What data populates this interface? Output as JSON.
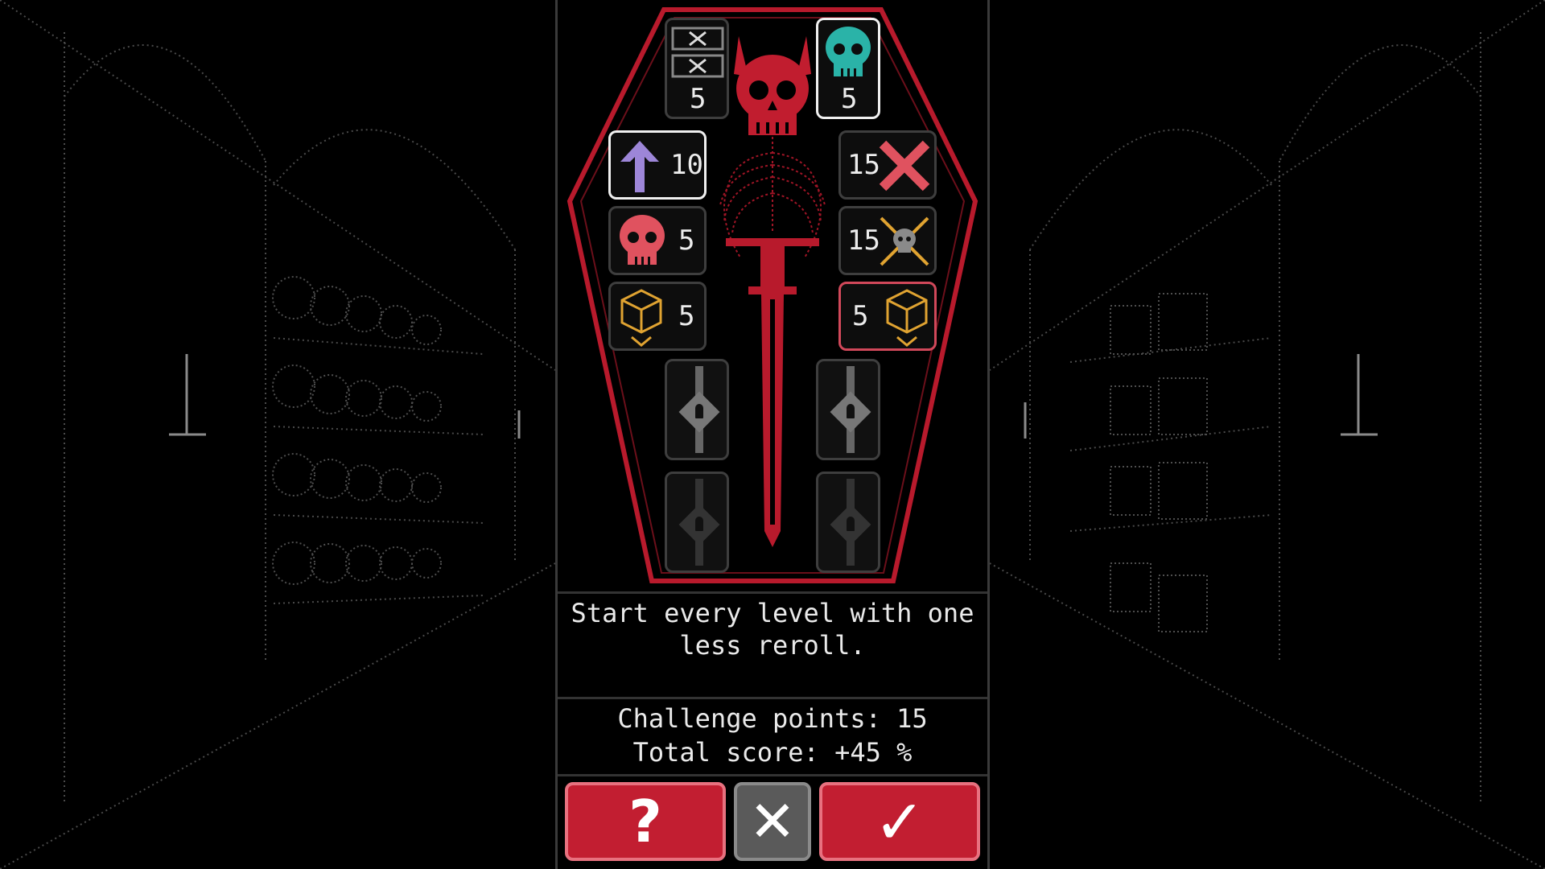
{
  "description": "Start every level with one less reroll.",
  "stats": {
    "challenge_points": "Challenge points: 15",
    "total_score": "Total score: +45 %"
  },
  "slots": {
    "rerolls": {
      "icon": "crossed-boxes-icon",
      "value": "5"
    },
    "skull_teal": {
      "icon": "teal-skull-icon",
      "value": "5"
    },
    "arrow_up": {
      "icon": "arrow-up-icon",
      "value": "10"
    },
    "red_cross": {
      "icon": "red-cross-icon",
      "value": "15"
    },
    "red_skull": {
      "icon": "red-skull-icon",
      "value": "5"
    },
    "crossed_bones": {
      "icon": "skull-crossbones-icon",
      "value": "15"
    },
    "dice_left": {
      "icon": "dice-down-icon",
      "value": "5"
    },
    "dice_right": {
      "icon": "dice-down-icon",
      "value": "5"
    }
  },
  "buttons": {
    "help": "?",
    "cancel": "✕",
    "confirm": "✓"
  },
  "colors": {
    "accent_red": "#c21e31",
    "coffin_red": "#b81a2c",
    "teal": "#2ab3a8",
    "purple": "#9d86d8",
    "gold": "#e0a331"
  }
}
